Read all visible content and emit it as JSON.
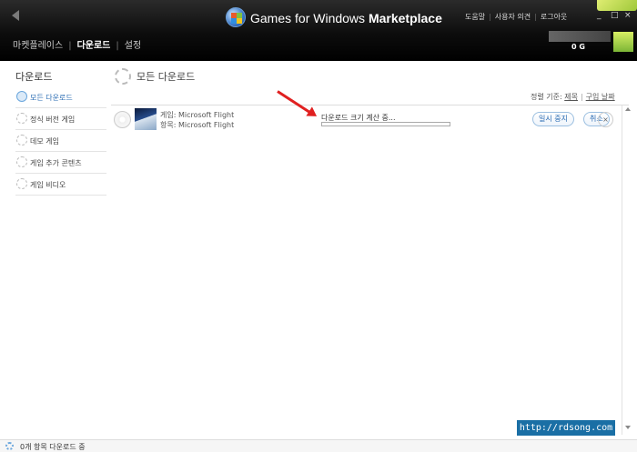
{
  "header": {
    "brand_regular": "Games for Windows",
    "brand_bold": "Marketplace",
    "links": [
      "도움말",
      "사용자 의견",
      "로그아웃"
    ],
    "minimize": "_",
    "maximize": "□",
    "close": "×",
    "nav": [
      "마켓플레이스",
      "다운로드",
      "설정"
    ],
    "nav_active": "다운로드",
    "gamerscore": "0 G"
  },
  "sidebar": {
    "heading": "다운로드",
    "items": [
      {
        "label": "모든 다운로드",
        "active": true
      },
      {
        "label": "정식 버전 게임",
        "active": false
      },
      {
        "label": "데모 게임",
        "active": false
      },
      {
        "label": "게임 추가 콘텐츠",
        "active": false
      },
      {
        "label": "게임 비디오",
        "active": false
      }
    ]
  },
  "main": {
    "title": "모든 다운로드",
    "sort_label": "정렬 기준:",
    "sort_options": [
      "제목",
      "구입 날짜"
    ],
    "download": {
      "game_line": "게임: Microsoft Flight",
      "item_line": "항목: Microsoft Flight",
      "status": "다운로드 크기 계산 중...",
      "progress": 0.0,
      "pause_label": "일시 중지",
      "cancel_label": "취소",
      "close_glyph": "×"
    }
  },
  "watermark": "http://rdsong.com",
  "statusbar": {
    "text": "0개 항목 다운로드 중"
  },
  "colors": {
    "accent": "#2b6cb3",
    "header_bg": "#000000",
    "arrow": "#e02020"
  },
  "icons": {
    "back": "back-arrow-icon",
    "logo": "games-for-windows-logo-icon",
    "download": "download-spinner-icon",
    "disc": "disc-icon"
  }
}
